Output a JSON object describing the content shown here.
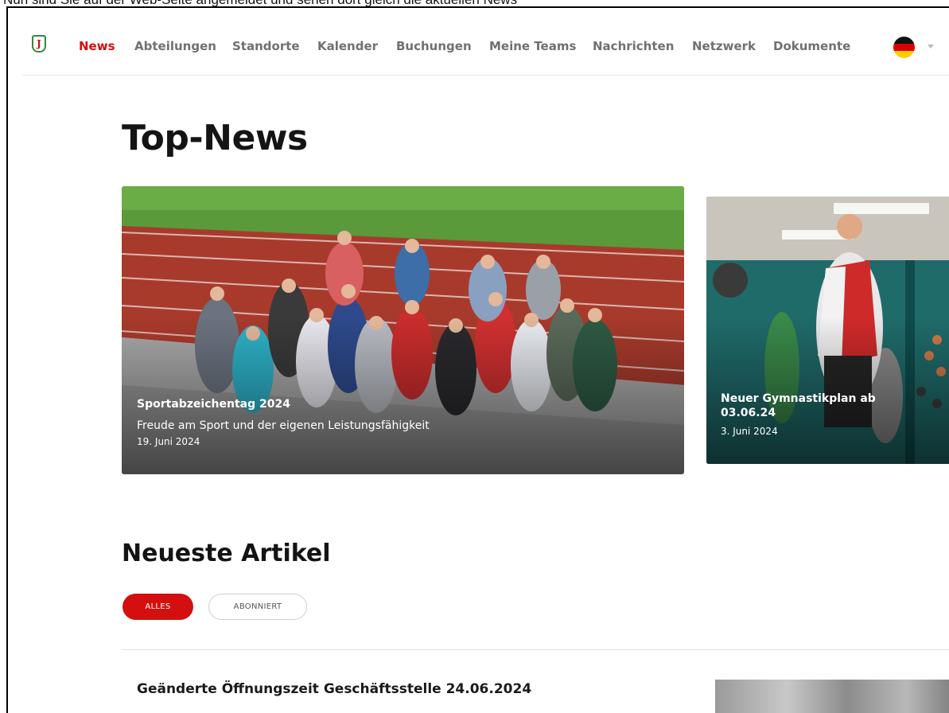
{
  "caption": "Nun sind Sie auf der Web-Seite angemeldet und sehen dort gleich die aktuellen News",
  "nav": {
    "items": [
      {
        "label": "News",
        "active": true
      },
      {
        "label": "Abteilungen"
      },
      {
        "label": "Standorte"
      },
      {
        "label": "Kalender"
      },
      {
        "label": "Buchungen"
      },
      {
        "label": "Meine Teams"
      },
      {
        "label": "Nachrichten"
      },
      {
        "label": "Netzwerk"
      },
      {
        "label": "Dokumente"
      }
    ],
    "language_icon": "germany-flag-icon",
    "accent_color": "#d40f0f"
  },
  "top_news": {
    "heading": "Top-News",
    "cards": [
      {
        "title": "Sportabzeichentag 2024",
        "subtitle": "Freude am Sport und der eigenen Leistungsfähigkeit",
        "date": "19. Juni 2024"
      },
      {
        "title": "Neuer Gymnastikplan ab 03.06.24",
        "date": "3. Juni 2024"
      }
    ]
  },
  "latest": {
    "heading": "Neueste Artikel",
    "filters": [
      "ALLES",
      "ABONNIERT"
    ],
    "articles": [
      {
        "title": "Geänderte Öffnungszeit Geschäftsstelle 24.06.2024"
      }
    ]
  }
}
